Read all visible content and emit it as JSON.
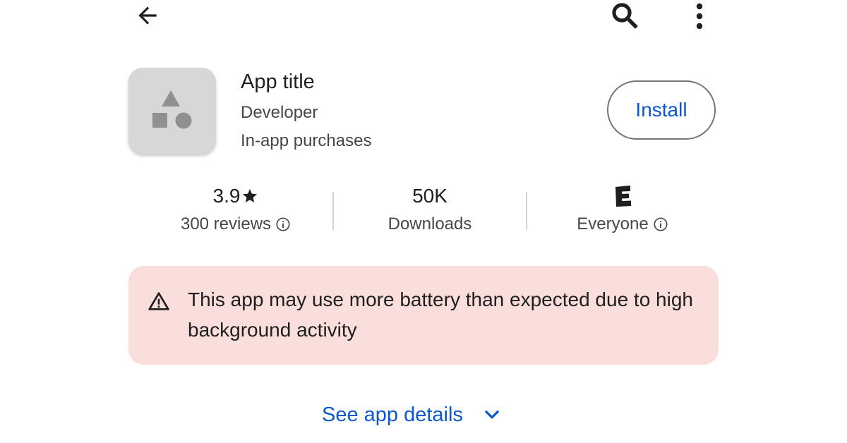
{
  "top_bar": {
    "back_icon": "arrow-back-icon",
    "search_icon": "search-icon",
    "more_icon": "more-vert-icon"
  },
  "app": {
    "title": "App title",
    "developer": "Developer",
    "purchases": "In-app purchases",
    "icon": "app-placeholder-shapes-icon",
    "install_label": "Install"
  },
  "stats": {
    "rating": {
      "value": "3.9",
      "icon": "star-icon",
      "label": "300 reviews",
      "info_icon": "info-icon"
    },
    "downloads": {
      "value": "50K",
      "label": "Downloads"
    },
    "content_rating": {
      "badge": "E",
      "label": "Everyone",
      "info_icon": "info-icon"
    }
  },
  "warning": {
    "icon": "warning-triangle-icon",
    "text": "This app may use more battery than expected due to high background activity"
  },
  "details": {
    "label": "See app details",
    "icon": "chevron-down-icon"
  },
  "colors": {
    "accent": "#0b57d0",
    "warning_bg": "#f9dedc",
    "icon_bg": "#d6d7d9",
    "placeholder_shape": "#8f9092"
  }
}
